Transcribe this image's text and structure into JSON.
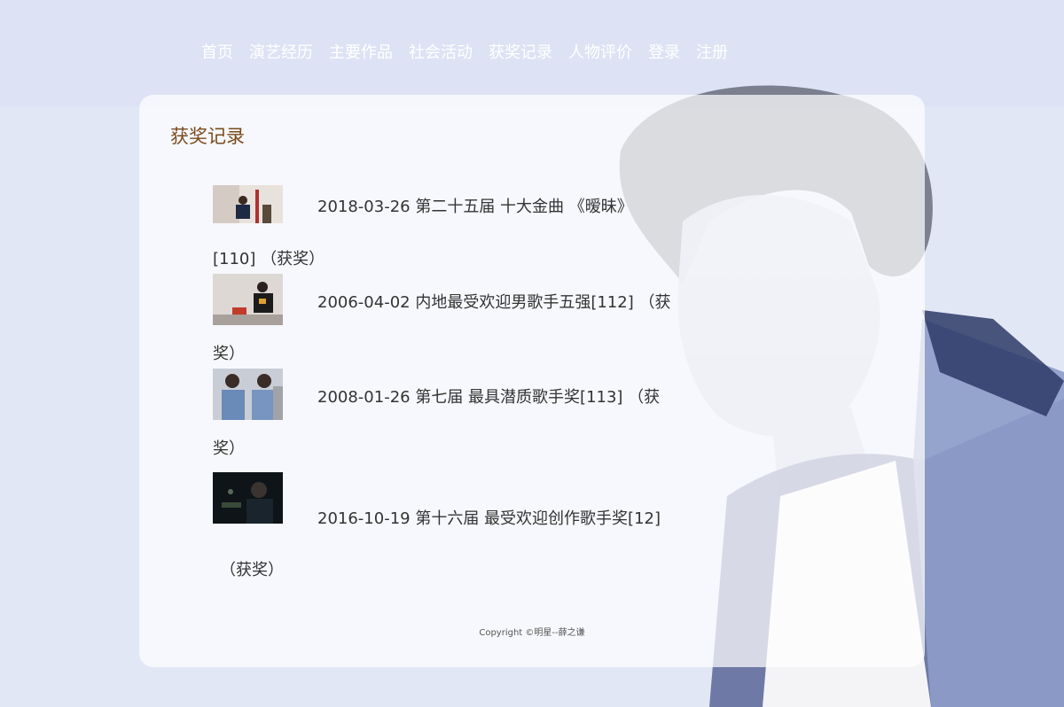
{
  "nav": {
    "items": [
      "首页",
      "演艺经历",
      "主要作品",
      "社会活动",
      "获奖记录",
      "人物评价",
      "登录",
      "注册"
    ]
  },
  "section": {
    "title": "获奖记录"
  },
  "awards": [
    {
      "line1": "2018-03-26 第二十五届 十大金曲 《暧昧》",
      "line2": "[110] （获奖）"
    },
    {
      "line1": "2006-04-02 内地最受欢迎男歌手五强[112] （获",
      "line2": "奖）"
    },
    {
      "line1": "2008-01-26 第七届 最具潜质歌手奖[113] （获",
      "line2": "奖）"
    },
    {
      "line1": "2016-10-19 第十六届 最受欢迎创作歌手奖[12]",
      "line2": "（获奖）"
    }
  ],
  "footer": {
    "copyright": "Copyright ©明星--薛之谦"
  },
  "colors": {
    "title": "#7a4a1c",
    "text": "#333333",
    "nav_text": "#ffffff",
    "background": "#dfe5f5"
  }
}
